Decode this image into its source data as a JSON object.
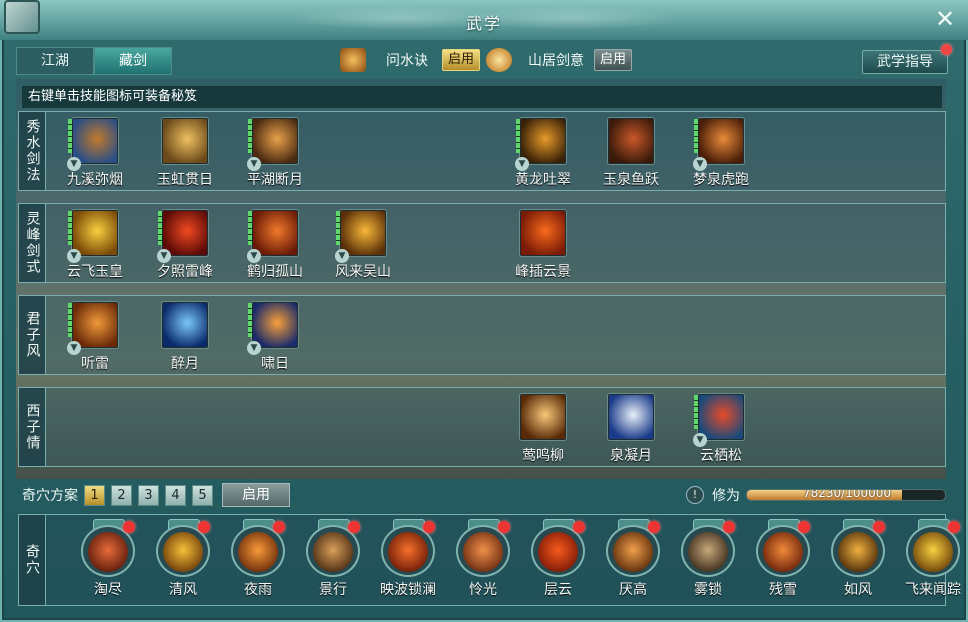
{
  "window": {
    "title": "武学",
    "close_label": "✕"
  },
  "tabs": [
    {
      "label": "江湖",
      "active": false
    },
    {
      "label": "藏剑",
      "active": true
    }
  ],
  "paths": [
    {
      "name": "问水诀",
      "status": "启用",
      "status_active": true,
      "icon": "wenshui-path-icon",
      "color": "#d18a2c"
    },
    {
      "name": "山居剑意",
      "status": "启用",
      "status_active": false,
      "icon": "shanju-path-icon",
      "color": "#e2a43a"
    }
  ],
  "guide_button": "武学指导",
  "hint": "右键单击技能图标可装备秘笈",
  "schools": [
    {
      "label": "秀水剑法",
      "skills": [
        {
          "name": "九溪弥烟",
          "icon": "jiuxi-icon",
          "colors": [
            "#2a4e86",
            "#c27a2a"
          ],
          "equippable": true
        },
        {
          "name": "玉虹贯日",
          "icon": "yuhong-icon",
          "colors": [
            "#6a4a1a",
            "#f0c060"
          ],
          "equippable": false
        },
        {
          "name": "平湖断月",
          "icon": "pinghu-icon",
          "colors": [
            "#4a2a12",
            "#e8a24a"
          ],
          "equippable": true
        },
        {
          "name": "黄龙吐翠",
          "icon": "huanglong-icon",
          "colors": [
            "#3a2208",
            "#e89a2a"
          ],
          "equippable": true
        },
        {
          "name": "玉泉鱼跃",
          "icon": "yuquan-icon",
          "colors": [
            "#3a1a0a",
            "#c8582a"
          ],
          "equippable": false
        },
        {
          "name": "梦泉虎跑",
          "icon": "mengquan-icon",
          "colors": [
            "#4a1e08",
            "#e88a3a"
          ],
          "equippable": true
        }
      ]
    },
    {
      "label": "灵峰剑式",
      "skills": [
        {
          "name": "云飞玉皇",
          "icon": "yunfei-icon",
          "colors": [
            "#7a4a08",
            "#f8d040"
          ],
          "equippable": true
        },
        {
          "name": "夕照雷峰",
          "icon": "xizhao-icon",
          "colors": [
            "#5a0a08",
            "#f04a20"
          ],
          "equippable": true
        },
        {
          "name": "鹤归孤山",
          "icon": "hegui-icon",
          "colors": [
            "#6a1a08",
            "#f07a2a"
          ],
          "equippable": true
        },
        {
          "name": "风来吴山",
          "icon": "fenglai-icon",
          "colors": [
            "#5a3008",
            "#f8b83a"
          ],
          "equippable": true
        },
        {
          "name": "峰插云景",
          "icon": "fengcha-icon",
          "colors": [
            "#7a1a08",
            "#f86a1a"
          ],
          "equippable": false
        }
      ]
    },
    {
      "label": "君子风",
      "skills": [
        {
          "name": "听雷",
          "icon": "tinglei-icon",
          "colors": [
            "#6a2a08",
            "#f09a3a"
          ],
          "equippable": true
        },
        {
          "name": "醉月",
          "icon": "zuiyue-icon",
          "colors": [
            "#0a2a6a",
            "#7ac8f8"
          ],
          "equippable": false
        },
        {
          "name": "啸日",
          "icon": "xiaori-icon",
          "colors": [
            "#1a2a6a",
            "#f8a03a"
          ],
          "equippable": true
        }
      ]
    },
    {
      "label": "西子情",
      "skills": [
        {
          "name": "莺鸣柳",
          "icon": "yingming-icon",
          "colors": [
            "#5a2a08",
            "#f8c87a"
          ],
          "equippable": false
        },
        {
          "name": "泉凝月",
          "icon": "quanning-icon",
          "colors": [
            "#1a3a8a",
            "#e8f0f8"
          ],
          "equippable": false
        },
        {
          "name": "云栖松",
          "icon": "yunqi-icon",
          "colors": [
            "#1a4a7a",
            "#e84a2a"
          ],
          "equippable": true
        }
      ]
    }
  ],
  "plan": {
    "label": "奇穴方案",
    "options": [
      "1",
      "2",
      "3",
      "4",
      "5"
    ],
    "selected": "1",
    "enable_label": "启用"
  },
  "cultivation": {
    "label": "修为",
    "info_icon": "!",
    "current": 78230,
    "max": 100000,
    "text": "78230/100000"
  },
  "acupoints": {
    "label": "奇穴",
    "items": [
      {
        "name": "淘尽",
        "icon": "taojin-icon",
        "colors": [
          "#5a1a0a",
          "#e86a3a"
        ]
      },
      {
        "name": "清风",
        "icon": "qingfeng-icon",
        "colors": [
          "#6a3a08",
          "#f8c03a"
        ]
      },
      {
        "name": "夜雨",
        "icon": "yeyu-icon",
        "colors": [
          "#6a2a0a",
          "#f89a3a"
        ]
      },
      {
        "name": "景行",
        "icon": "jingxing-icon",
        "colors": [
          "#4a2a12",
          "#d8a05a"
        ]
      },
      {
        "name": "映波锁澜",
        "icon": "yingbo-icon",
        "colors": [
          "#6a1a08",
          "#f8702a"
        ]
      },
      {
        "name": "怜光",
        "icon": "lianguang-icon",
        "colors": [
          "#6a2a10",
          "#f0904a"
        ]
      },
      {
        "name": "层云",
        "icon": "cengyun-icon",
        "colors": [
          "#7a1808",
          "#f85a1a"
        ]
      },
      {
        "name": "厌高",
        "icon": "yangao-icon",
        "colors": [
          "#5a2a0a",
          "#f0a04a"
        ]
      },
      {
        "name": "雾锁",
        "icon": "wusuo-icon",
        "colors": [
          "#3a2a1a",
          "#c8a87a"
        ]
      },
      {
        "name": "残雪",
        "icon": "canxue-icon",
        "colors": [
          "#6a200a",
          "#f08a3a"
        ]
      },
      {
        "name": "如风",
        "icon": "rufeng-icon",
        "colors": [
          "#4a2a08",
          "#f0b040"
        ]
      },
      {
        "name": "飞来闻踪",
        "icon": "feilai-icon",
        "colors": [
          "#6a4008",
          "#f8d040"
        ]
      }
    ]
  }
}
